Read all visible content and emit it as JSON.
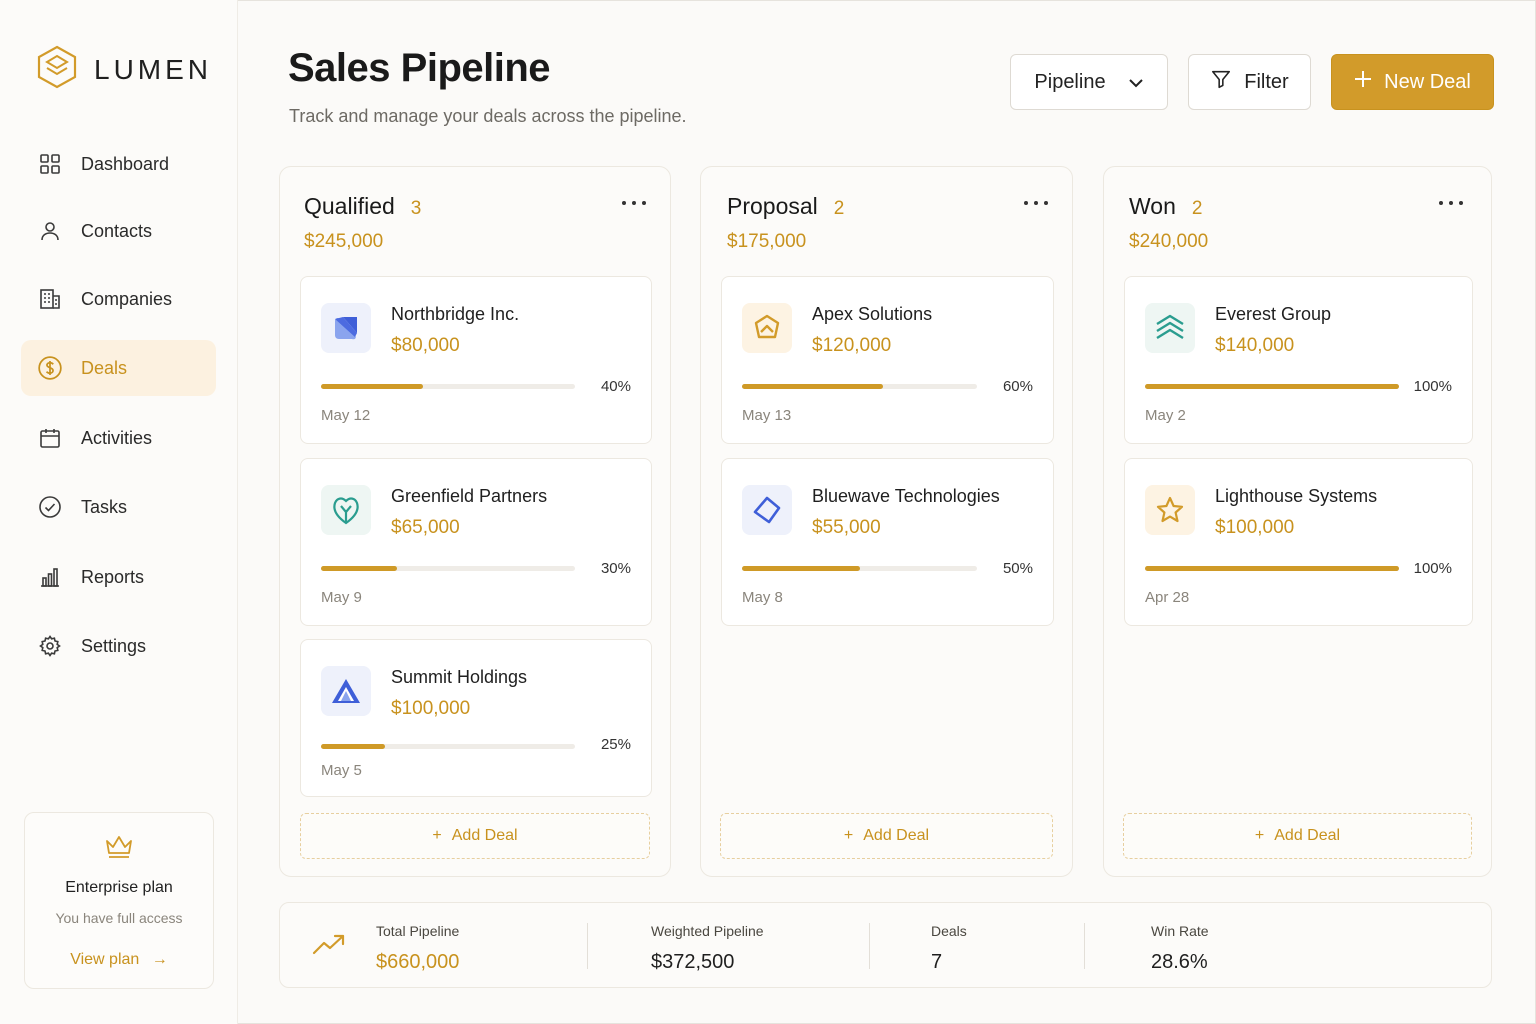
{
  "brand": {
    "name": "LUMEN",
    "logo_icon": "hexagon-logo-icon"
  },
  "colors": {
    "accent": "#d29b2a",
    "accent_text": "#c8921e",
    "active_bg": "#fcf1e0"
  },
  "sidebar": {
    "items": [
      {
        "label": "Dashboard",
        "icon": "grid-icon",
        "active": false
      },
      {
        "label": "Contacts",
        "icon": "user-icon",
        "active": false
      },
      {
        "label": "Companies",
        "icon": "building-icon",
        "active": false
      },
      {
        "label": "Deals",
        "icon": "dollar-circle-icon",
        "active": true
      },
      {
        "label": "Activities",
        "icon": "calendar-icon",
        "active": false
      },
      {
        "label": "Tasks",
        "icon": "check-circle-icon",
        "active": false
      },
      {
        "label": "Reports",
        "icon": "bar-chart-icon",
        "active": false
      },
      {
        "label": "Settings",
        "icon": "gear-icon",
        "active": false
      }
    ],
    "plan": {
      "title": "Enterprise plan",
      "subtitle": "You have full access",
      "link": "View plan",
      "icon": "crown-icon"
    }
  },
  "header": {
    "title": "Sales Pipeline",
    "subtitle": "Track and manage your deals across the pipeline.",
    "view_select": "Pipeline",
    "filter_label": "Filter",
    "new_deal_label": "New Deal"
  },
  "columns": [
    {
      "title": "Qualified",
      "count": "3",
      "total": "$245,000",
      "deals": [
        {
          "name": "Northbridge Inc.",
          "amount": "$80,000",
          "progress": 40,
          "progress_label": "40%",
          "date": "May 12",
          "logo": "northbridge-logo-icon"
        },
        {
          "name": "Greenfield Partners",
          "amount": "$65,000",
          "progress": 30,
          "progress_label": "30%",
          "date": "May 9",
          "logo": "greenfield-logo-icon"
        },
        {
          "name": "Summit Holdings",
          "amount": "$100,000",
          "progress": 25,
          "progress_label": "25%",
          "date": "May 5",
          "logo": "summit-logo-icon"
        }
      ],
      "add_label": "Add Deal"
    },
    {
      "title": "Proposal",
      "count": "2",
      "total": "$175,000",
      "deals": [
        {
          "name": "Apex Solutions",
          "amount": "$120,000",
          "progress": 60,
          "progress_label": "60%",
          "date": "May 13",
          "logo": "apex-logo-icon"
        },
        {
          "name": "Bluewave Technologies",
          "amount": "$55,000",
          "progress": 50,
          "progress_label": "50%",
          "date": "May 8",
          "logo": "bluewave-logo-icon"
        }
      ],
      "add_label": "Add Deal"
    },
    {
      "title": "Won",
      "count": "2",
      "total": "$240,000",
      "deals": [
        {
          "name": "Everest Group",
          "amount": "$140,000",
          "progress": 100,
          "progress_label": "100%",
          "date": "May 2",
          "logo": "everest-logo-icon"
        },
        {
          "name": "Lighthouse Systems",
          "amount": "$100,000",
          "progress": 100,
          "progress_label": "100%",
          "date": "Apr 28",
          "logo": "star-logo-icon"
        }
      ],
      "add_label": "Add Deal"
    }
  ],
  "summary": {
    "icon": "trending-up-icon",
    "items": [
      {
        "label": "Total Pipeline",
        "value": "$660,000"
      },
      {
        "label": "Weighted Pipeline",
        "value": "$372,500"
      },
      {
        "label": "Deals",
        "value": "7"
      },
      {
        "label": "Win Rate",
        "value": "28.6%"
      }
    ]
  }
}
